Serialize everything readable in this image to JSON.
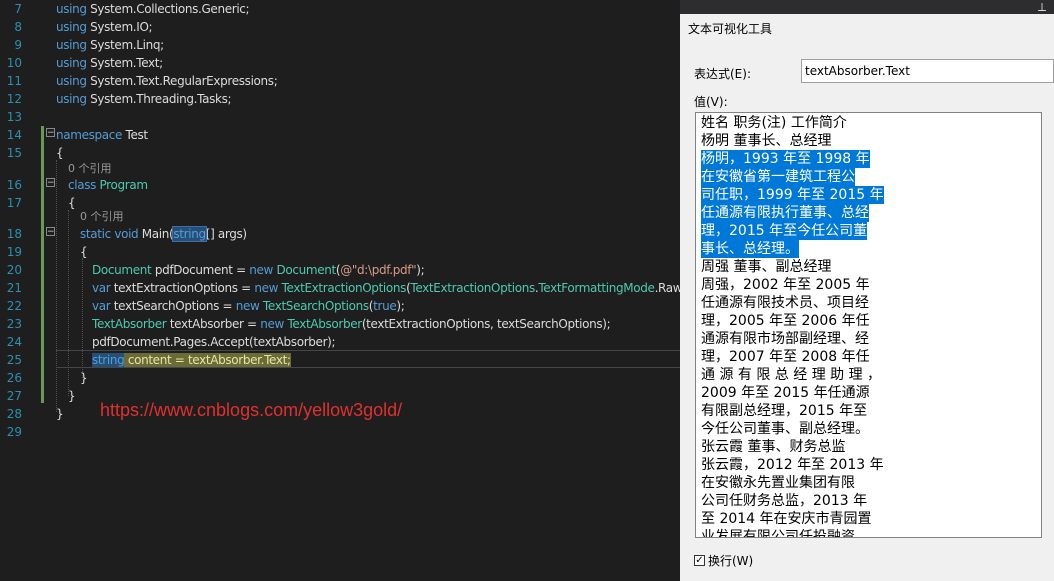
{
  "editor": {
    "line_numbers": [
      "7",
      "8",
      "9",
      "10",
      "11",
      "12",
      "13",
      "14",
      "15",
      "16",
      "17",
      "18",
      "19",
      "20",
      "21",
      "22",
      "23",
      "24",
      "25",
      "26",
      "27",
      "28",
      "29"
    ],
    "code": {
      "l7": {
        "kw": "using",
        "rest": " System.Collections.Generic;"
      },
      "l8": {
        "kw": "using",
        "rest": " System.IO;"
      },
      "l9": {
        "kw": "using",
        "rest": " System.Linq;"
      },
      "l10": {
        "kw": "using",
        "rest": " System.Text;"
      },
      "l11": {
        "kw": "using",
        "rest": " System.Text.RegularExpressions;"
      },
      "l12": {
        "kw": "using",
        "rest": " System.Threading.Tasks;"
      },
      "l14": {
        "kw": "namespace",
        "rest": " Test"
      },
      "l15": "{",
      "ref1": "0 个引用",
      "l16": {
        "kw": "class",
        "name": " Program"
      },
      "l17": "{",
      "ref2": "0 个引用",
      "l18": {
        "kw1": "static",
        "kw2": " void",
        "name": " Main(",
        "kw3": "string",
        "rest": "[] args)"
      },
      "l19": "{",
      "l20": {
        "t1": "Document",
        "a": " pdfDocument = ",
        "kw": "new",
        "t2": " Document",
        "b": "(",
        "s": "@\"d:\\pdf.pdf\"",
        "c": ");"
      },
      "l21": {
        "kw1": "var",
        "a": " textExtractionOptions = ",
        "kw2": "new",
        "t1": " TextExtractionOptions",
        "b": "(",
        "t2": "TextExtractionOptions",
        "c": ".",
        "t3": "TextFormattingMode",
        "d": ".Raw);"
      },
      "l22": {
        "kw1": "var",
        "a": " textSearchOptions = ",
        "kw2": "new",
        "t1": " TextSearchOptions",
        "b": "(",
        "kw3": "true",
        "c": ");"
      },
      "l23": {
        "t1": "TextAbsorber",
        "a": " textAbsorber = ",
        "kw": "new",
        "t2": " TextAbsorber",
        "b": "(textExtractionOptions, textSearchOptions);"
      },
      "l24": "pdfDocument.Pages.Accept(textAbsorber);",
      "l25": {
        "kw": "string",
        "rest": " content = textAbsorber.Text;"
      },
      "l26": "}",
      "l27": "}",
      "l28": "}"
    },
    "url": "https://www.cnblogs.com/yellow3gold/"
  },
  "visualizer": {
    "title": "文本可视化工具",
    "expression_label": "表达式(E):",
    "expression_value": "textAbsorber.Text",
    "value_label": "值(V):",
    "value_lines": [
      "姓名 职务(注) 工作简介",
      "杨明 董事长、总经理",
      "杨明，1993 年至 1998 年",
      "在安徽省第一建筑工程公",
      "司任职，1999 年至 2015 年",
      "任通源有限执行董事、总经",
      "理，2015 年至今任公司董",
      "事长、总经理。",
      "周强 董事、副总经理",
      "周强，2002 年至 2005 年",
      "任通源有限技术员、项目经",
      "理，2005 年至 2006 年任",
      "通源有限市场部副经理、经",
      "理，2007 年至 2008 年任",
      "通 源 有 限 总 经 理 助 理 ，",
      "2009 年至 2015 年任通源",
      "有限副总经理，2015 年至",
      "今任公司董事、副总经理。",
      "张云霞 董事、财务总监",
      "张云霞，2012 年至 2013 年",
      "在安徽永先置业集团有限",
      "公司任财务总监，2013 年",
      "至 2014 年在安庆市青园置",
      "业发展有限公司任投融资"
    ],
    "wrap_label": "换行(W)",
    "wrap_checked": true
  },
  "colors": {
    "keyword": "#569cd6",
    "type": "#4ec9b0",
    "string": "#d69d85",
    "selection": "#0078d7"
  },
  "icons": {
    "pin": "pin-icon"
  }
}
